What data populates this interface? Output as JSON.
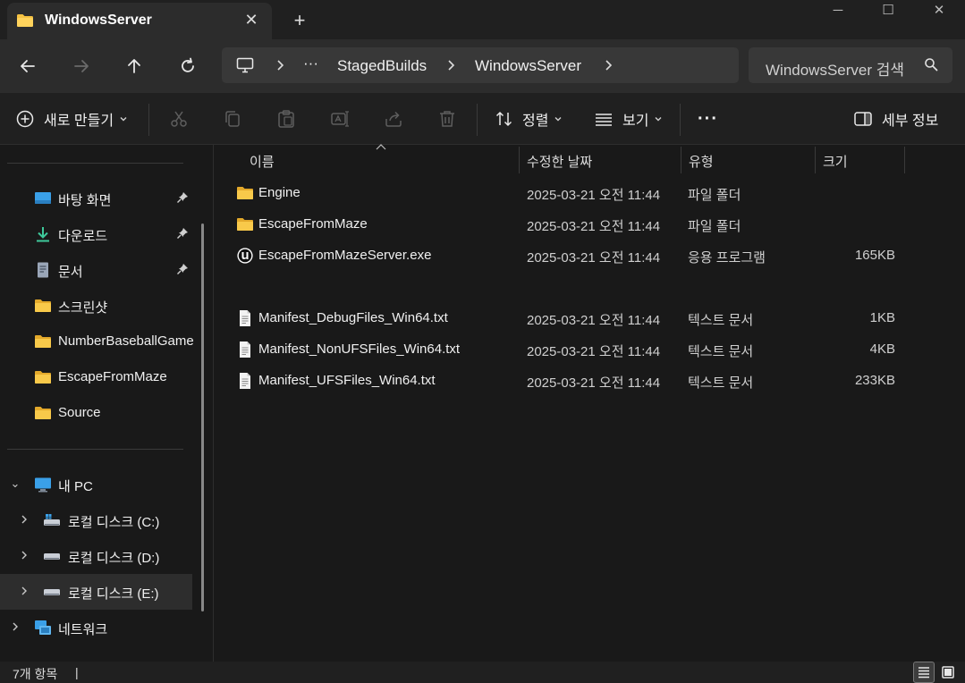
{
  "window": {
    "tab_title": "WindowsServer",
    "tab_close": "✕",
    "new_tab": "+",
    "minimize": "─",
    "maximize": "☐",
    "close": "✕"
  },
  "nav": {
    "breadcrumbs": [
      "StagedBuilds",
      "WindowsServer"
    ],
    "overflow": "···",
    "search_placeholder": "WindowsServer 검색"
  },
  "commands": {
    "new": "새로 만들기",
    "sort": "정렬",
    "view": "보기",
    "more": "···",
    "details": "세부 정보"
  },
  "sidebar": {
    "quick_access": [
      {
        "label": "바탕 화면",
        "icon": "desktop-icon",
        "pinned": true
      },
      {
        "label": "다운로드",
        "icon": "download-icon",
        "pinned": true
      },
      {
        "label": "문서",
        "icon": "document-icon",
        "pinned": true
      },
      {
        "label": "스크린샷",
        "icon": "folder-icon",
        "pinned": false
      },
      {
        "label": "NumberBaseballGame",
        "icon": "folder-icon",
        "pinned": false
      },
      {
        "label": "EscapeFromMaze",
        "icon": "folder-icon",
        "pinned": false
      },
      {
        "label": "Source",
        "icon": "folder-icon",
        "pinned": false
      }
    ],
    "this_pc": "내 PC",
    "drives": [
      "로컬 디스크 (C:)",
      "로컬 디스크 (D:)",
      "로컬 디스크 (E:)"
    ],
    "network": "네트워크"
  },
  "columns": {
    "name": "이름",
    "date": "수정한 날짜",
    "type": "유형",
    "size": "크기"
  },
  "files": [
    {
      "name": "Engine",
      "date": "2025-03-21 오전 11:44",
      "type": "파일 폴더",
      "size": "",
      "icon": "folder-icon"
    },
    {
      "name": "EscapeFromMaze",
      "date": "2025-03-21 오전 11:44",
      "type": "파일 폴더",
      "size": "",
      "icon": "folder-icon"
    },
    {
      "name": "EscapeFromMazeServer.exe",
      "date": "2025-03-21 오전 11:44",
      "type": "응용 프로그램",
      "size": "165KB",
      "icon": "unreal-engine-icon"
    },
    {
      "name": "Manifest_DebugFiles_Win64.txt",
      "date": "2025-03-21 오전 11:44",
      "type": "텍스트 문서",
      "size": "1KB",
      "icon": "text-file-icon"
    },
    {
      "name": "Manifest_NonUFSFiles_Win64.txt",
      "date": "2025-03-21 오전 11:44",
      "type": "텍스트 문서",
      "size": "4KB",
      "icon": "text-file-icon"
    },
    {
      "name": "Manifest_UFSFiles_Win64.txt",
      "date": "2025-03-21 오전 11:44",
      "type": "텍스트 문서",
      "size": "233KB",
      "icon": "text-file-icon"
    }
  ],
  "status": {
    "item_count": "7개 항목",
    "cursor": "|"
  },
  "colors": {
    "folder": "#f5c242",
    "accent": "#4cc2ff"
  }
}
